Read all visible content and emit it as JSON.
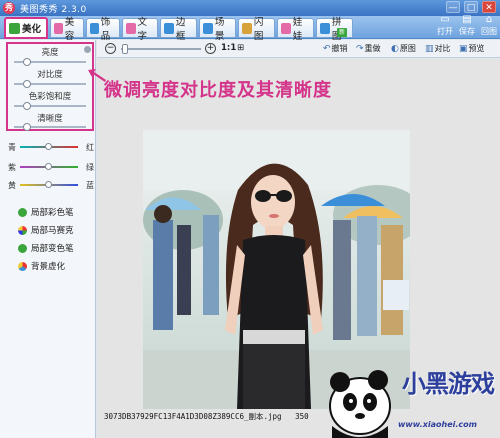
{
  "app": {
    "title": "美图秀秀 2.3.0",
    "logo_glyph": "秀",
    "window_buttons": [
      "—",
      "□",
      "✕"
    ]
  },
  "tabs": [
    {
      "label": "美化",
      "icon": "palette-icon",
      "color": "#3aa53a",
      "active": true
    },
    {
      "label": "美容",
      "icon": "face-icon",
      "color": "#e36aa6"
    },
    {
      "label": "饰品",
      "icon": "ornament-icon",
      "color": "#3b8fd8"
    },
    {
      "label": "文字",
      "icon": "text-icon",
      "color": "#e36aa6"
    },
    {
      "label": "边框",
      "icon": "frame-icon",
      "color": "#3b8fd8"
    },
    {
      "label": "场景",
      "icon": "scene-icon",
      "color": "#3b8fd8"
    },
    {
      "label": "闪图",
      "icon": "flash-icon",
      "color": "#d8a23b"
    },
    {
      "label": "娃娃",
      "icon": "doll-icon",
      "color": "#e36aa6"
    },
    {
      "label": "拼图",
      "icon": "puzzle-icon",
      "color": "#3b8fd8"
    }
  ],
  "new_badge": "新",
  "top_actions": [
    {
      "label": "打开",
      "icon": "folder-icon",
      "glyph": "▭"
    },
    {
      "label": "保存",
      "icon": "save-icon",
      "glyph": "▤"
    },
    {
      "label": "回图",
      "icon": "home-icon",
      "glyph": "⌂"
    }
  ],
  "adjustments": [
    {
      "label": "亮度",
      "level": 0.18
    },
    {
      "label": "对比度",
      "level": 0.18
    },
    {
      "label": "色彩饱和度",
      "level": 0.18
    },
    {
      "label": "清晰度",
      "level": 0.18
    }
  ],
  "color_balance": [
    {
      "left": "青",
      "right": "红",
      "gradient": "linear-gradient(90deg,#00b3b3,#e03030)",
      "level": 0.5
    },
    {
      "left": "紫",
      "right": "绿",
      "gradient": "linear-gradient(90deg,#b040c0,#30b030)",
      "level": 0.5
    },
    {
      "left": "黄",
      "right": "蓝",
      "gradient": "linear-gradient(90deg,#e0c020,#3050e0)",
      "level": 0.5
    }
  ],
  "tools": [
    {
      "label": "局部彩色笔",
      "icon": "color-brush-icon",
      "color": "#3aa53a"
    },
    {
      "label": "局部马赛克",
      "icon": "mosaic-icon",
      "color": "#d8a23b"
    },
    {
      "label": "局部变色笔",
      "icon": "recolor-brush-icon",
      "color": "#3aa53a"
    },
    {
      "label": "背景虚化",
      "icon": "blur-icon",
      "color": "#3b8fd8"
    }
  ],
  "toolbar": {
    "zoom_out": "−",
    "zoom_in": "+",
    "ratio_label": "1:1",
    "fit_label": "⊞",
    "zoom_level": 0.05,
    "actions": [
      {
        "label": "撤销",
        "icon": "undo-icon",
        "glyph": "↶"
      },
      {
        "label": "重做",
        "icon": "redo-icon",
        "glyph": "↷"
      },
      {
        "label": "原图",
        "icon": "original-icon",
        "glyph": "◐"
      },
      {
        "label": "对比",
        "icon": "compare-icon",
        "glyph": "▥"
      },
      {
        "label": "预览",
        "icon": "preview-icon",
        "glyph": "▣"
      }
    ]
  },
  "annotation": "微调亮度对比度及其清晰度",
  "canvas": {
    "filename": "3073DB37929FC13F4A1D3D08Z389CC6_副本.jpg",
    "extra": "350"
  },
  "watermark": {
    "title": "小黑游戏",
    "url": "www.xiaohei.com"
  }
}
